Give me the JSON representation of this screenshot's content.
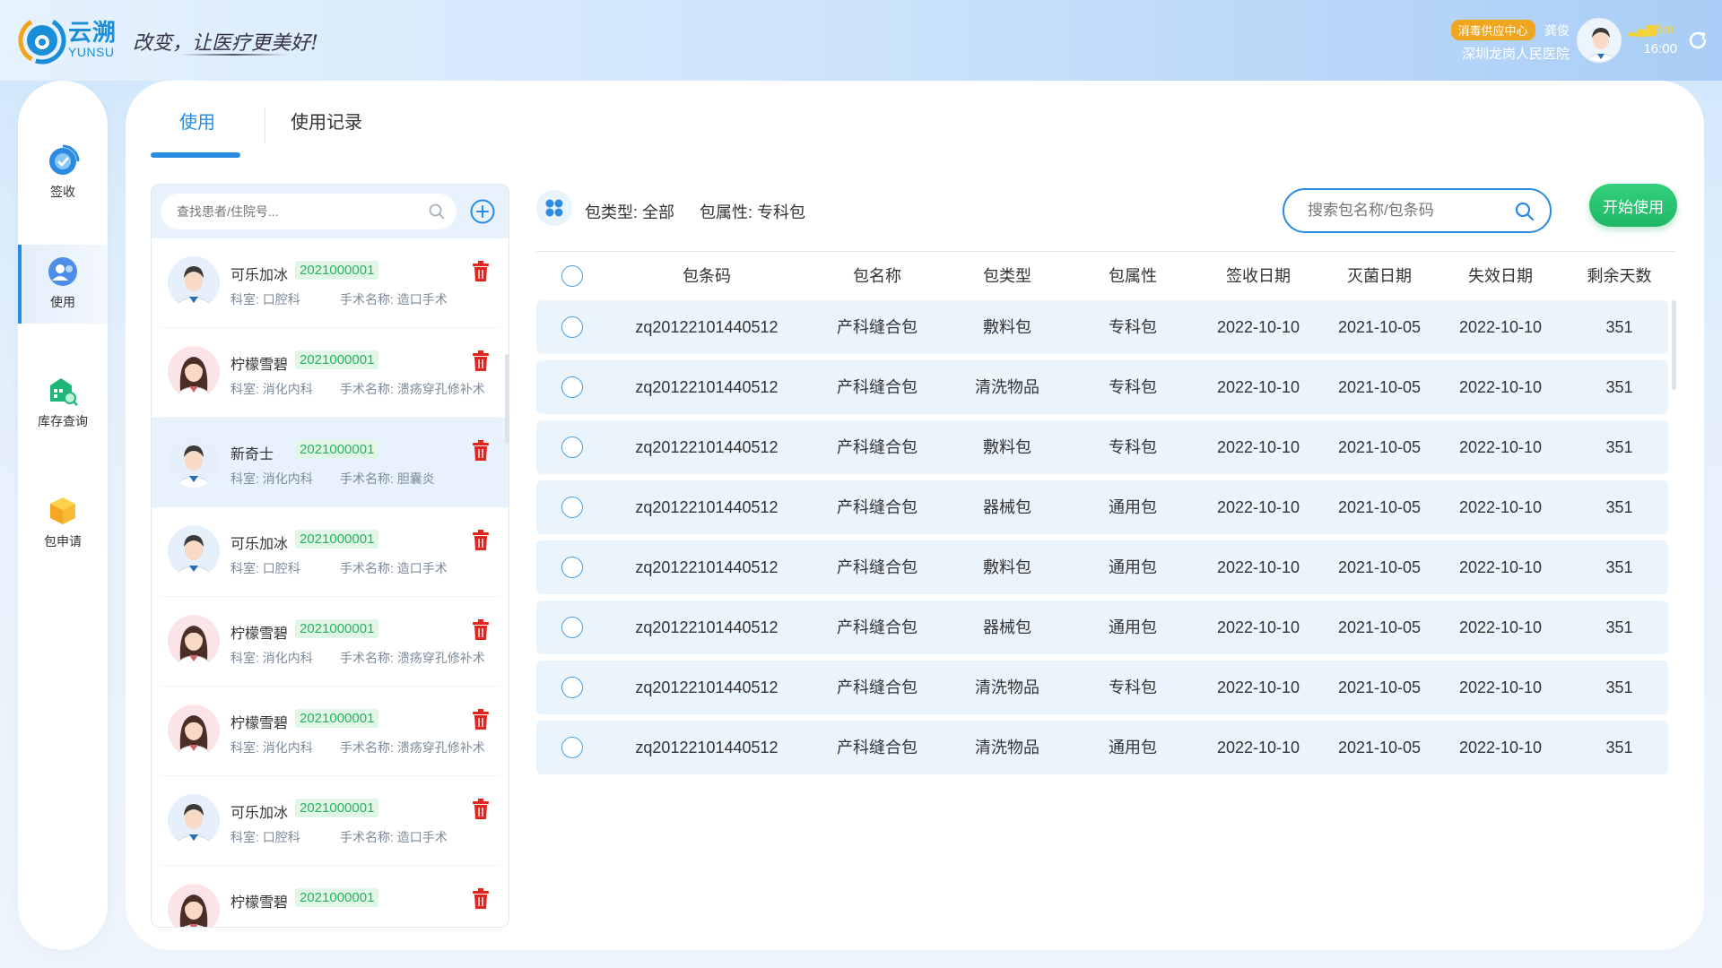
{
  "header": {
    "brand_cn": "云溯",
    "brand_en": "YUNSU",
    "slogan": "改变，让医疗更美好!",
    "dept_badge": "消毒供应中心",
    "user_name": "龚俊",
    "hospital": "深圳龙岗人民医院",
    "signal": "5m",
    "time": "16:00"
  },
  "sidebar": {
    "items": [
      {
        "label": "签收"
      },
      {
        "label": "使用"
      },
      {
        "label": "库存查询"
      },
      {
        "label": "包申请"
      }
    ]
  },
  "tabs": [
    {
      "label": "使用"
    },
    {
      "label": "使用记录"
    }
  ],
  "patient_search": {
    "placeholder": "查找患者/住院号..."
  },
  "patients": [
    {
      "name": "可乐加冰",
      "id": "2021000001",
      "dept": "科室: 口腔科",
      "op": "手术名称: 造口手术",
      "gender": "male"
    },
    {
      "name": "柠檬雪碧",
      "id": "2021000001",
      "dept": "科室: 消化内科",
      "op": "手术名称: 溃疡穿孔修补术",
      "gender": "female"
    },
    {
      "name": "新奇士",
      "id": "2021000001",
      "dept": "科室: 消化内科",
      "op": "手术名称: 胆囊炎",
      "gender": "male"
    },
    {
      "name": "可乐加冰",
      "id": "2021000001",
      "dept": "科室: 口腔科",
      "op": "手术名称: 造口手术",
      "gender": "male"
    },
    {
      "name": "柠檬雪碧",
      "id": "2021000001",
      "dept": "科室: 消化内科",
      "op": "手术名称: 溃疡穿孔修补术",
      "gender": "female"
    },
    {
      "name": "柠檬雪碧",
      "id": "2021000001",
      "dept": "科室: 消化内科",
      "op": "手术名称: 溃疡穿孔修补术",
      "gender": "female"
    },
    {
      "name": "可乐加冰",
      "id": "2021000001",
      "dept": "科室: 口腔科",
      "op": "手术名称: 造口手术",
      "gender": "male"
    },
    {
      "name": "柠檬雪碧",
      "id": "2021000001",
      "dept": "",
      "op": "",
      "gender": "female"
    }
  ],
  "filters": {
    "type": "包类型: 全部",
    "attr": "包属性: 专科包"
  },
  "pkg_search": {
    "placeholder": "搜索包名称/包条码"
  },
  "start_button": "开始使用",
  "table": {
    "columns": [
      "包条码",
      "包名称",
      "包类型",
      "包属性",
      "签收日期",
      "灭菌日期",
      "失效日期",
      "剩余天数"
    ],
    "rows": [
      [
        "zq20122101440512",
        "产科缝合包",
        "敷料包",
        "专科包",
        "2022-10-10",
        "2021-10-05",
        "2022-10-10",
        "351"
      ],
      [
        "zq20122101440512",
        "产科缝合包",
        "清洗物品",
        "专科包",
        "2022-10-10",
        "2021-10-05",
        "2022-10-10",
        "351"
      ],
      [
        "zq20122101440512",
        "产科缝合包",
        "敷料包",
        "专科包",
        "2022-10-10",
        "2021-10-05",
        "2022-10-10",
        "351"
      ],
      [
        "zq20122101440512",
        "产科缝合包",
        "器械包",
        "通用包",
        "2022-10-10",
        "2021-10-05",
        "2022-10-10",
        "351"
      ],
      [
        "zq20122101440512",
        "产科缝合包",
        "敷料包",
        "通用包",
        "2022-10-10",
        "2021-10-05",
        "2022-10-10",
        "351"
      ],
      [
        "zq20122101440512",
        "产科缝合包",
        "器械包",
        "通用包",
        "2022-10-10",
        "2021-10-05",
        "2022-10-10",
        "351"
      ],
      [
        "zq20122101440512",
        "产科缝合包",
        "清洗物品",
        "专科包",
        "2022-10-10",
        "2021-10-05",
        "2022-10-10",
        "351"
      ],
      [
        "zq20122101440512",
        "产科缝合包",
        "清洗物品",
        "通用包",
        "2022-10-10",
        "2021-10-05",
        "2022-10-10",
        "351"
      ]
    ]
  },
  "colors": {
    "accent": "#2a8be0",
    "success": "#20b866",
    "danger": "#e0251f",
    "badge": "#f0a51f"
  }
}
